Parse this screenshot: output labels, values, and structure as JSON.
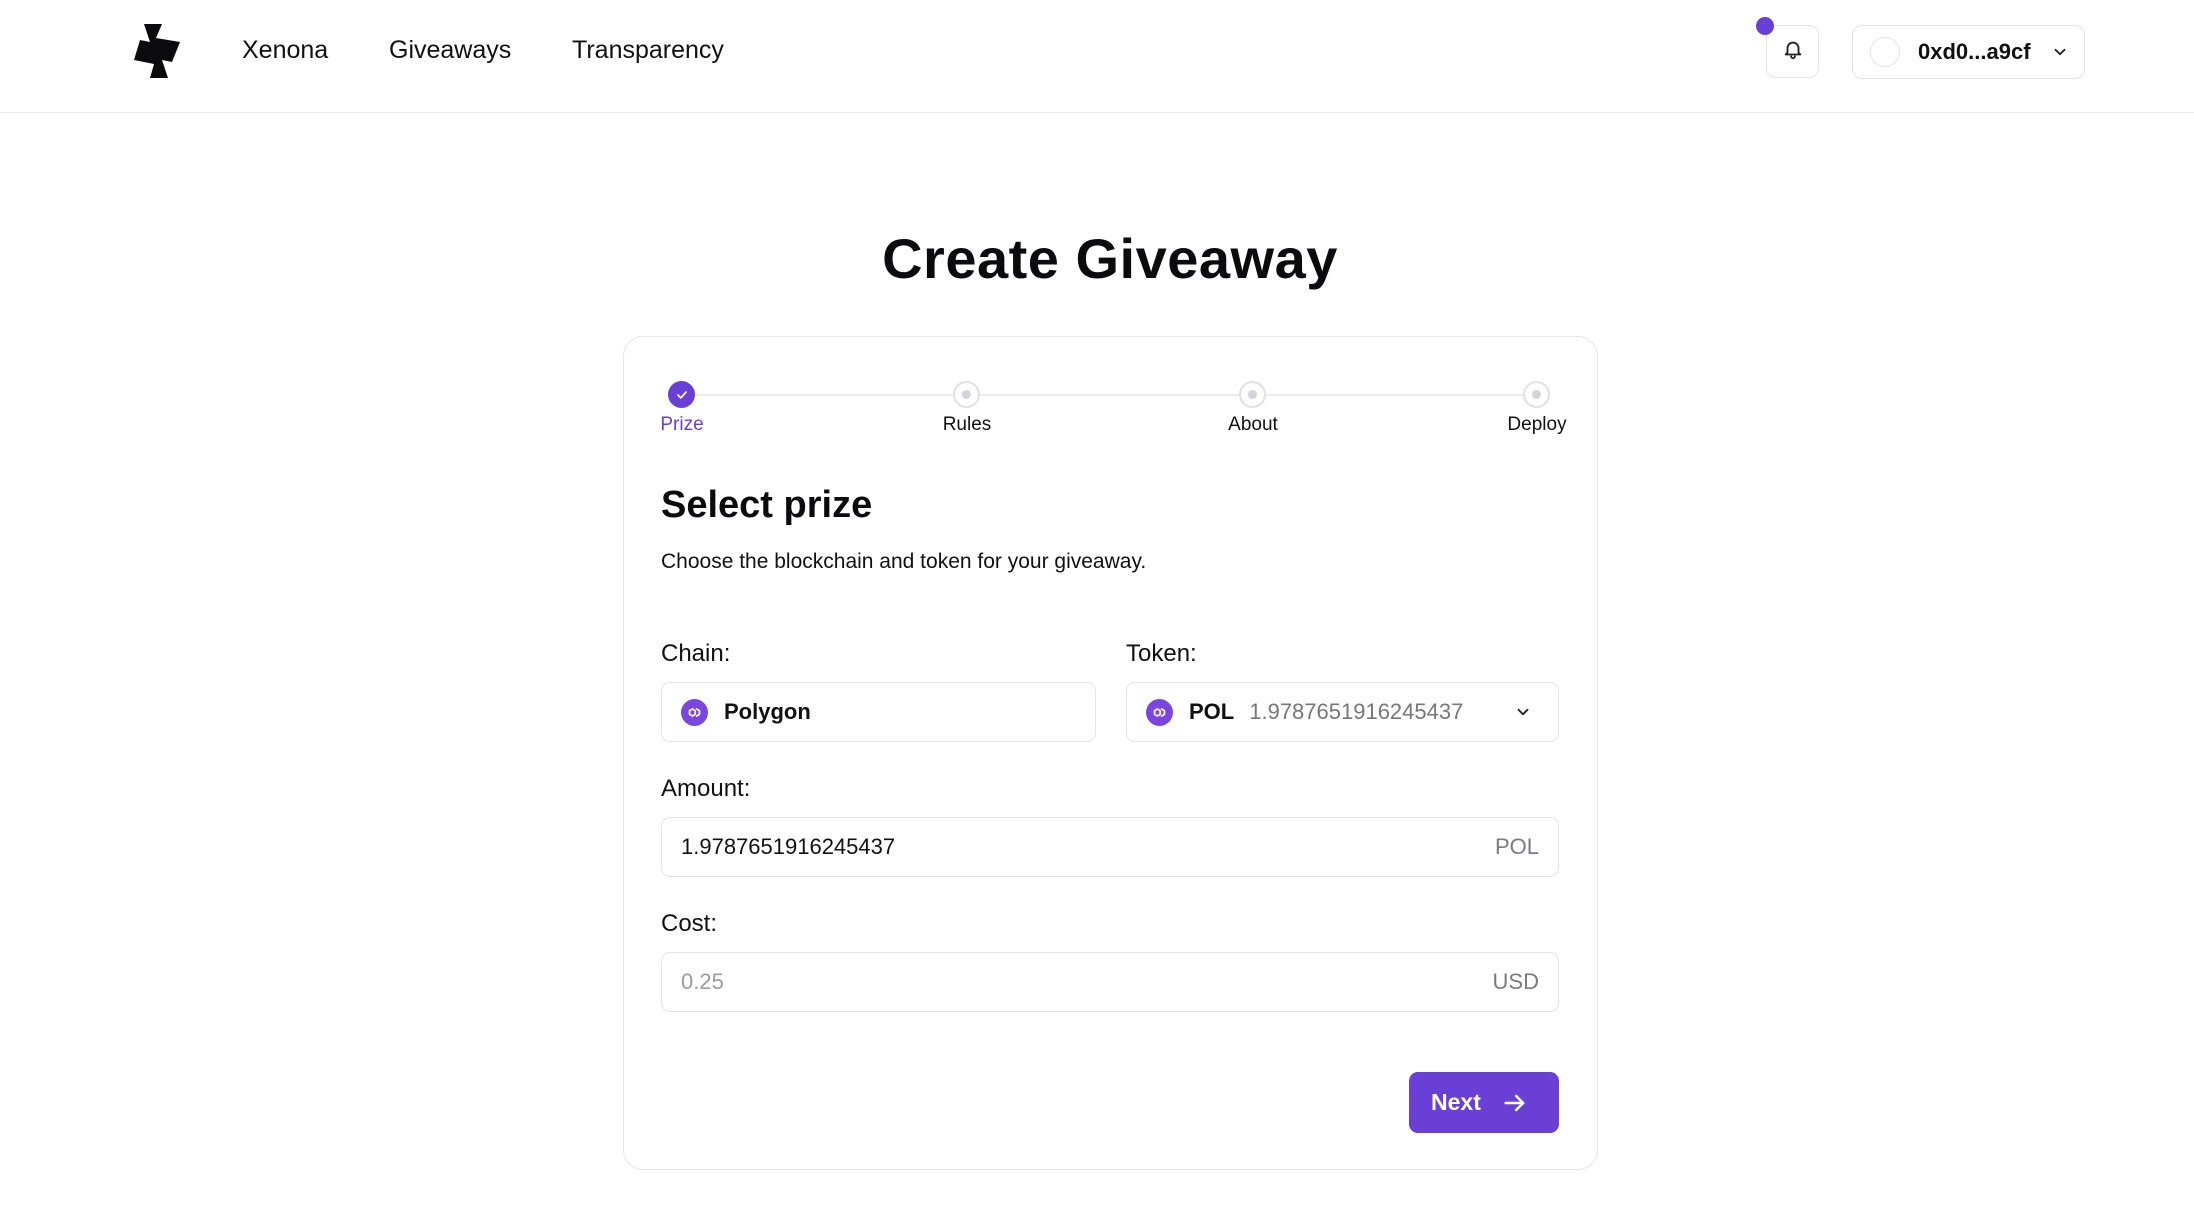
{
  "header": {
    "nav": [
      "Xenona",
      "Giveaways",
      "Transparency"
    ],
    "wallet_address": "0xd0...a9cf"
  },
  "page_title": "Create Giveaway",
  "stepper": {
    "steps": [
      "Prize",
      "Rules",
      "About",
      "Deploy"
    ],
    "active_index": 0
  },
  "section": {
    "title": "Select prize",
    "description": "Choose the blockchain and token for your giveaway."
  },
  "form": {
    "chain_label": "Chain:",
    "chain_value": "Polygon",
    "token_label": "Token:",
    "token_symbol": "POL",
    "token_balance": "1.9787651916245437",
    "amount_label": "Amount:",
    "amount_value": "1.9787651916245437",
    "amount_suffix": "POL",
    "cost_label": "Cost:",
    "cost_value": "0.25",
    "cost_suffix": "USD"
  },
  "actions": {
    "next_label": "Next"
  },
  "colors": {
    "accent": "#6a3fd6",
    "border": "#e3e3e8"
  },
  "icons": [
    "logo-icon",
    "bell-icon",
    "chevron-down-icon",
    "check-icon",
    "polygon-icon",
    "arrow-right-icon"
  ]
}
